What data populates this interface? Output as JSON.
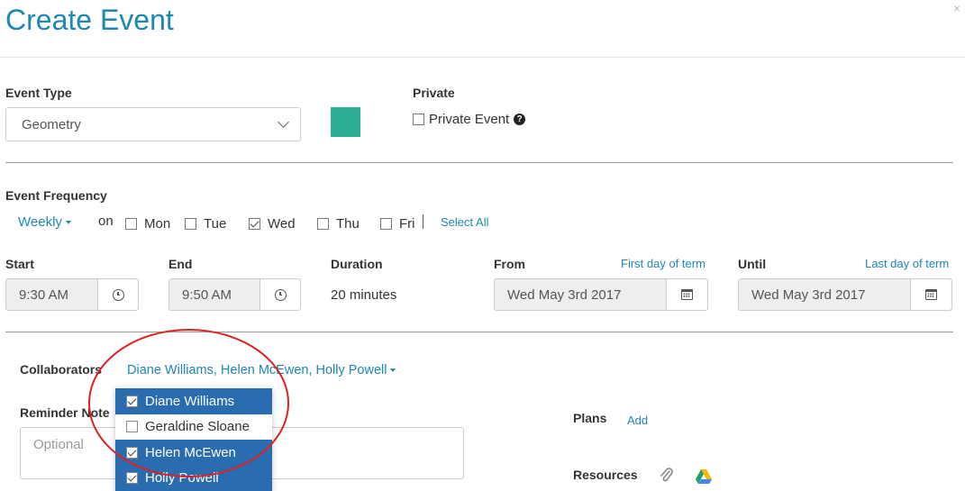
{
  "header": {
    "title": "Create Event",
    "close": "×"
  },
  "event_type": {
    "label": "Event Type",
    "value": "Geometry",
    "color": "#2eae97"
  },
  "private": {
    "label": "Private",
    "checkbox_label": "Private Event",
    "checked": false
  },
  "frequency": {
    "label": "Event Frequency",
    "value": "Weekly",
    "on_label": "on",
    "days": [
      {
        "label": "Mon",
        "checked": false
      },
      {
        "label": "Tue",
        "checked": false
      },
      {
        "label": "Wed",
        "checked": true
      },
      {
        "label": "Thu",
        "checked": false
      },
      {
        "label": "Fri",
        "checked": false
      }
    ],
    "select_all": "Select All"
  },
  "times": {
    "start_label": "Start",
    "start_value": "9:30 AM",
    "end_label": "End",
    "end_value": "9:50 AM",
    "duration_label": "Duration",
    "duration_value": "20 minutes",
    "from_label": "From",
    "from_link": "First day of term",
    "from_value": "Wed May 3rd 2017",
    "until_label": "Until",
    "until_link": "Last day of term",
    "until_value": "Wed May 3rd 2017"
  },
  "collaborators": {
    "label": "Collaborators",
    "value": "Diane Williams, Helen McEwen, Holly Powell",
    "options": [
      {
        "label": "Diane Williams",
        "checked": true
      },
      {
        "label": "Geraldine Sloane",
        "checked": false
      },
      {
        "label": "Helen McEwen",
        "checked": true
      },
      {
        "label": "Holly Powell",
        "checked": true
      }
    ]
  },
  "reminder": {
    "label": "Reminder Note",
    "placeholder": "Optional"
  },
  "plans": {
    "label": "Plans",
    "add": "Add"
  },
  "resources": {
    "label": "Resources"
  }
}
